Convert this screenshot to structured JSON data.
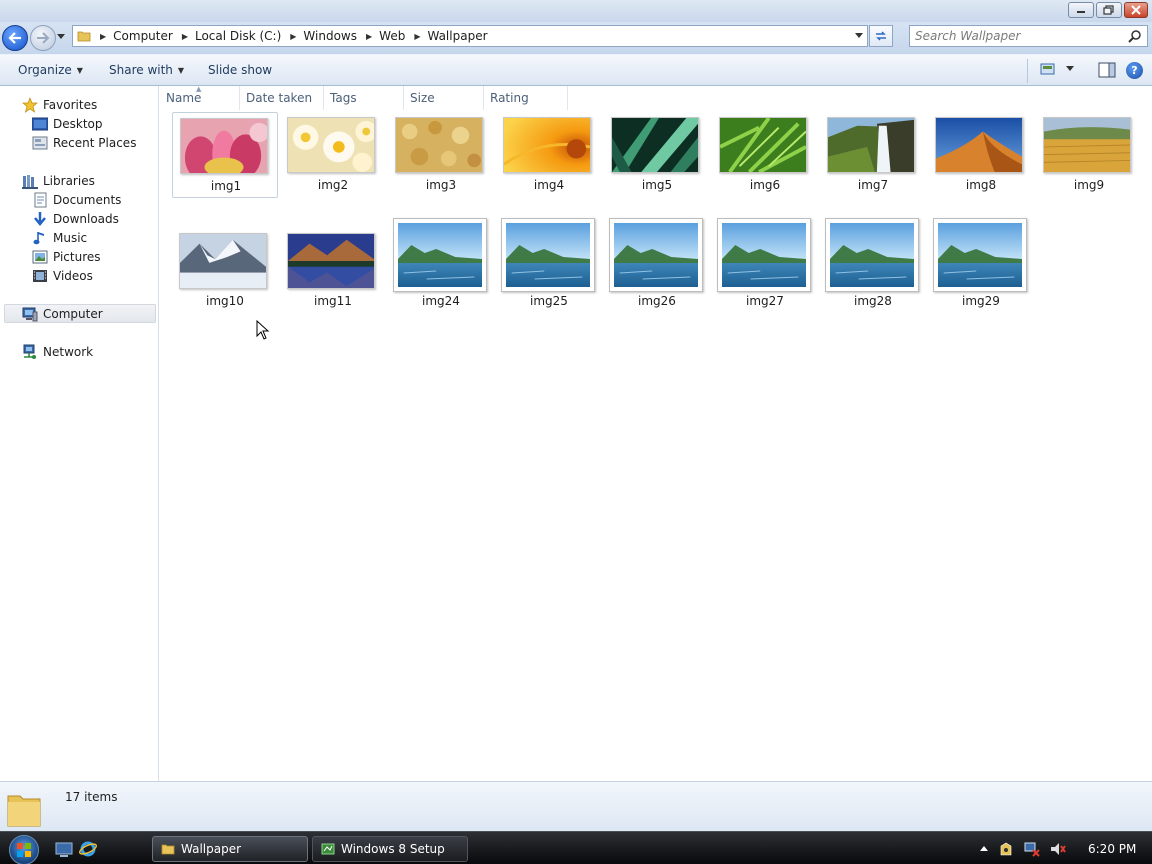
{
  "window": {
    "title_buttons": [
      "minimize",
      "maximize",
      "close"
    ]
  },
  "address": {
    "crumbs": [
      "Computer",
      "Local Disk (C:)",
      "Windows",
      "Web",
      "Wallpaper"
    ],
    "search_placeholder": "Search Wallpaper"
  },
  "toolbar": {
    "organize": "Organize",
    "share_with": "Share with",
    "slide_show": "Slide show"
  },
  "nav": {
    "favorites": "Favorites",
    "desktop": "Desktop",
    "recent_places": "Recent Places",
    "libraries": "Libraries",
    "documents": "Documents",
    "downloads": "Downloads",
    "music": "Music",
    "pictures": "Pictures",
    "videos": "Videos",
    "computer": "Computer",
    "network": "Network"
  },
  "columns": [
    "Name",
    "Date taken",
    "Tags",
    "Size",
    "Rating"
  ],
  "files": [
    {
      "name": "img1",
      "icon": "pink-flower"
    },
    {
      "name": "img2",
      "icon": "white-flowers"
    },
    {
      "name": "img3",
      "icon": "golden-texture"
    },
    {
      "name": "img4",
      "icon": "orange-flower"
    },
    {
      "name": "img5",
      "icon": "green-leaves"
    },
    {
      "name": "img6",
      "icon": "fern"
    },
    {
      "name": "img7",
      "icon": "waterfall"
    },
    {
      "name": "img8",
      "icon": "dunes"
    },
    {
      "name": "img9",
      "icon": "wheat-field"
    },
    {
      "name": "img10",
      "icon": "snowy-mountains"
    },
    {
      "name": "img11",
      "icon": "mountain-lake"
    },
    {
      "name": "img24",
      "icon": "lake-landscape"
    },
    {
      "name": "img25",
      "icon": "lake-landscape"
    },
    {
      "name": "img26",
      "icon": "lake-landscape"
    },
    {
      "name": "img27",
      "icon": "lake-landscape"
    },
    {
      "name": "img28",
      "icon": "lake-landscape"
    },
    {
      "name": "img29",
      "icon": "lake-landscape"
    }
  ],
  "status": {
    "item_count": "17 items"
  },
  "taskbar": {
    "tasks": [
      "Wallpaper",
      "Windows 8 Setup"
    ],
    "clock": "6:20 PM"
  }
}
